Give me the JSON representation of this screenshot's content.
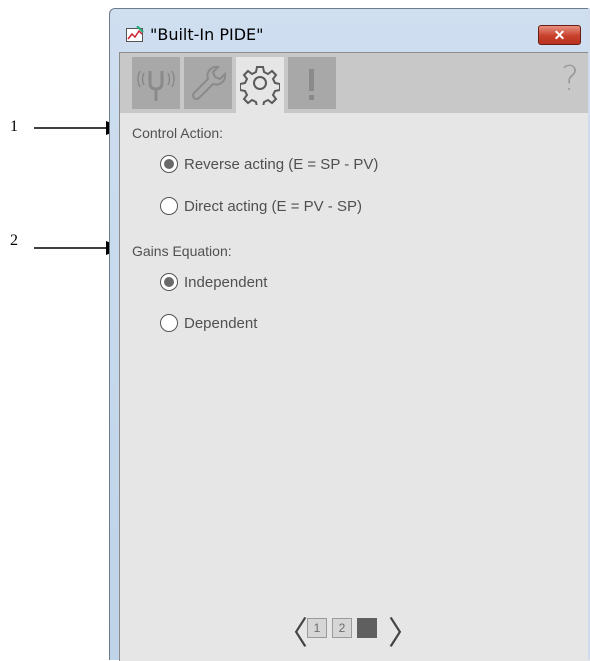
{
  "callouts": [
    {
      "number": "1"
    },
    {
      "number": "2"
    }
  ],
  "window": {
    "title": "\"Built-In PIDE\"",
    "close_label": "✕"
  },
  "tabs": [
    {
      "icon": "tuning-fork-icon",
      "active": false
    },
    {
      "icon": "wrench-icon",
      "active": false
    },
    {
      "icon": "gear-icon",
      "active": true
    },
    {
      "icon": "exclamation-icon",
      "active": false
    }
  ],
  "help_label": "?",
  "control_action": {
    "label": "Control Action:",
    "options": [
      {
        "label": "Reverse acting (E = SP - PV)",
        "checked": true
      },
      {
        "label": "Direct acting (E = PV - SP)",
        "checked": false
      }
    ]
  },
  "gains_equation": {
    "label": "Gains Equation:",
    "options": [
      {
        "label": "Independent",
        "checked": true
      },
      {
        "label": "Dependent",
        "checked": false
      }
    ]
  },
  "pager": {
    "prev": "〈",
    "next": "〉",
    "pages": [
      "1",
      "2",
      "3"
    ],
    "current": "3"
  }
}
